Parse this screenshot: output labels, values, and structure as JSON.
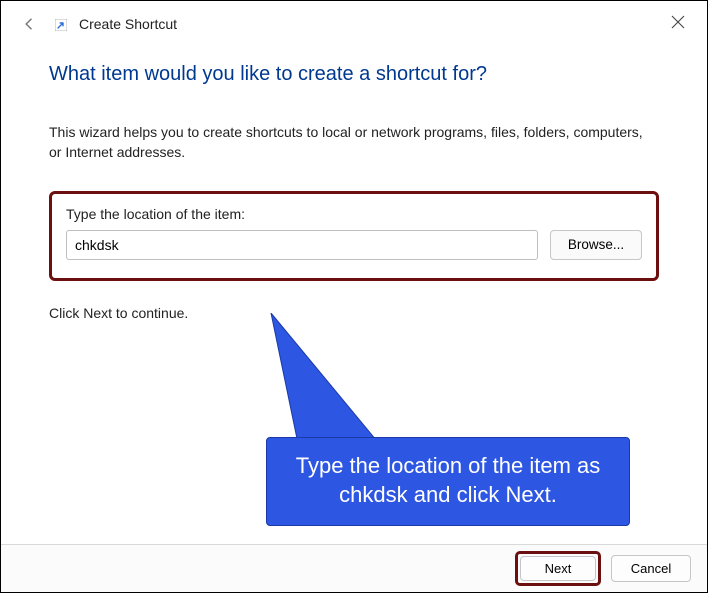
{
  "header": {
    "title": "Create Shortcut"
  },
  "main": {
    "heading": "What item would you like to create a shortcut for?",
    "description": "This wizard helps you to create shortcuts to local or network programs, files, folders, computers, or Internet addresses.",
    "field_label": "Type the location of the item:",
    "location_value": "chkdsk",
    "browse_label": "Browse...",
    "continue_hint": "Click Next to continue."
  },
  "annotation": {
    "callout_text": "Type the location of the item as chkdsk and click Next."
  },
  "footer": {
    "next_label": "Next",
    "cancel_label": "Cancel"
  }
}
